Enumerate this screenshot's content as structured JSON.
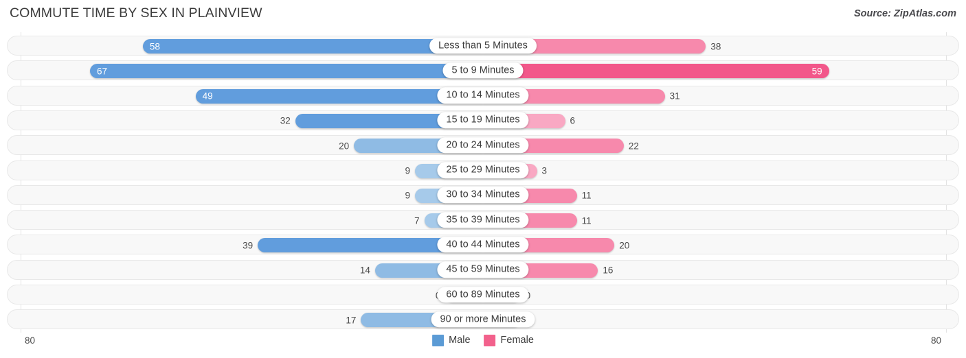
{
  "header": {
    "title": "COMMUTE TIME BY SEX IN PLAINVIEW",
    "source": "Source: ZipAtlas.com"
  },
  "axis": {
    "left_tick": "80",
    "right_tick": "80",
    "max": 80
  },
  "legend": {
    "items": [
      {
        "label": "Male",
        "color": "#5b9bd5"
      },
      {
        "label": "Female",
        "color": "#f2618c"
      }
    ]
  },
  "colors": {
    "male_strong": "#619ddd",
    "male_light": "#a6caea",
    "female_strong": "#f2578a",
    "female_light": "#f9a8c3",
    "track": "#f8f8f8",
    "track_border": "#e8e8e8"
  },
  "chart_data": {
    "type": "bar",
    "orientation": "horizontal-diverging",
    "title": "COMMUTE TIME BY SEX IN PLAINVIEW",
    "xlabel": "",
    "ylabel": "",
    "xlim": [
      80,
      80
    ],
    "grid": false,
    "legend_position": "bottom-center",
    "categories": [
      "Less than 5 Minutes",
      "5 to 9 Minutes",
      "10 to 14 Minutes",
      "15 to 19 Minutes",
      "20 to 24 Minutes",
      "25 to 29 Minutes",
      "30 to 34 Minutes",
      "35 to 39 Minutes",
      "40 to 44 Minutes",
      "45 to 59 Minutes",
      "60 to 89 Minutes",
      "90 or more Minutes"
    ],
    "series": [
      {
        "name": "Male",
        "values": [
          58,
          67,
          49,
          32,
          20,
          9,
          9,
          7,
          39,
          14,
          0,
          17
        ]
      },
      {
        "name": "Female",
        "values": [
          38,
          59,
          31,
          6,
          22,
          3,
          11,
          11,
          20,
          16,
          0,
          0
        ]
      }
    ]
  },
  "rows": [
    {
      "label": "Less than 5 Minutes",
      "male": "58",
      "female": "38",
      "male_inside": true,
      "female_inside": false,
      "male_pct": 72.5,
      "female_pct": 47.5,
      "male_tone": "strong",
      "female_tone": "mid"
    },
    {
      "label": "5 to 9 Minutes",
      "male": "67",
      "female": "59",
      "male_inside": true,
      "female_inside": true,
      "male_pct": 83.75,
      "female_pct": 73.75,
      "male_tone": "strong",
      "female_tone": "strong"
    },
    {
      "label": "10 to 14 Minutes",
      "male": "49",
      "female": "31",
      "male_inside": true,
      "female_inside": false,
      "male_pct": 61.25,
      "female_pct": 38.75,
      "male_tone": "strong",
      "female_tone": "mid"
    },
    {
      "label": "15 to 19 Minutes",
      "male": "32",
      "female": "6",
      "male_inside": false,
      "female_inside": false,
      "male_pct": 40.0,
      "female_pct": 17.5,
      "male_tone": "strong",
      "female_tone": "light"
    },
    {
      "label": "20 to 24 Minutes",
      "male": "20",
      "female": "22",
      "male_inside": false,
      "female_inside": false,
      "male_pct": 27.5,
      "female_pct": 30.0,
      "male_tone": "mid",
      "female_tone": "mid"
    },
    {
      "label": "25 to 29 Minutes",
      "male": "9",
      "female": "3",
      "male_inside": false,
      "female_inside": false,
      "male_pct": 14.5,
      "female_pct": 11.5,
      "male_tone": "light",
      "female_tone": "light"
    },
    {
      "label": "30 to 34 Minutes",
      "male": "9",
      "female": "11",
      "male_inside": false,
      "female_inside": false,
      "male_pct": 14.5,
      "female_pct": 20.0,
      "male_tone": "light",
      "female_tone": "mid"
    },
    {
      "label": "35 to 39 Minutes",
      "male": "7",
      "female": "11",
      "male_inside": false,
      "female_inside": false,
      "male_pct": 12.5,
      "female_pct": 20.0,
      "male_tone": "light",
      "female_tone": "mid"
    },
    {
      "label": "40 to 44 Minutes",
      "male": "39",
      "female": "20",
      "male_inside": false,
      "female_inside": false,
      "male_pct": 48.0,
      "female_pct": 28.0,
      "male_tone": "strong",
      "female_tone": "mid"
    },
    {
      "label": "45 to 59 Minutes",
      "male": "14",
      "female": "16",
      "male_inside": false,
      "female_inside": false,
      "male_pct": 23.0,
      "female_pct": 24.5,
      "male_tone": "mid",
      "female_tone": "mid"
    },
    {
      "label": "60 to 89 Minutes",
      "male": "0",
      "female": "0",
      "male_inside": false,
      "female_inside": false,
      "male_pct": 8.0,
      "female_pct": 8.0,
      "male_tone": "light",
      "female_tone": "light"
    },
    {
      "label": "90 or more Minutes",
      "male": "17",
      "female": "0",
      "male_inside": false,
      "female_inside": false,
      "male_pct": 26.0,
      "female_pct": 8.0,
      "male_tone": "mid",
      "female_tone": "light"
    }
  ]
}
